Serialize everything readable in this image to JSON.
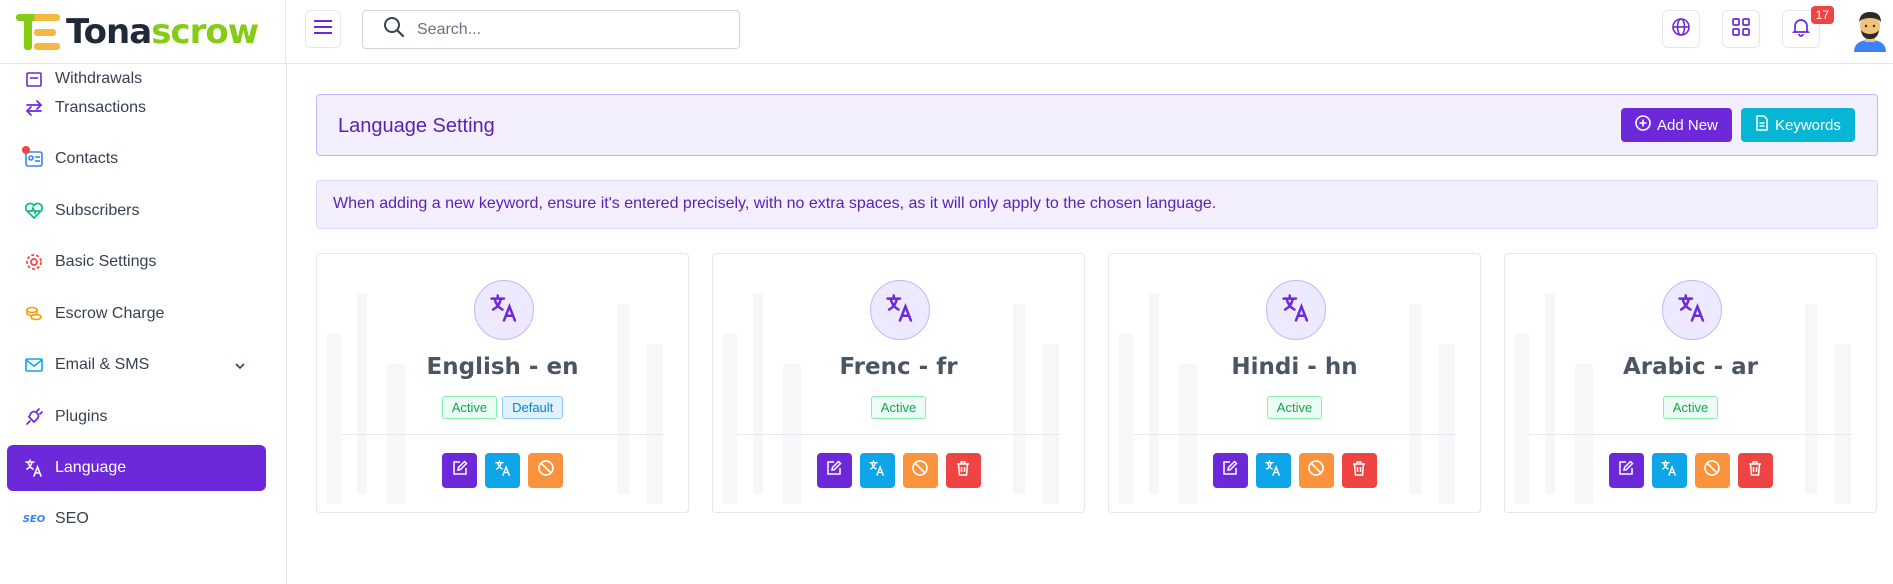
{
  "brand": {
    "name_part1": "Tona",
    "name_part2": "scrow",
    "colors": {
      "dark": "#1f2937",
      "accent": "#84cc16",
      "yellow": "#f5b942"
    }
  },
  "header": {
    "search_placeholder": "Search...",
    "notification_count": "17",
    "icons": [
      "menu-icon",
      "search-icon",
      "globe-icon",
      "grid-icon",
      "bell-icon"
    ]
  },
  "sidebar": {
    "items": [
      {
        "label": "Withdrawals",
        "icon": "receipt-icon"
      },
      {
        "label": "Transactions",
        "icon": "arrows-left-right-icon"
      },
      {
        "label": "Contacts",
        "icon": "contact-card-icon"
      },
      {
        "label": "Subscribers",
        "icon": "heart-pulse-icon"
      },
      {
        "label": "Basic Settings",
        "icon": "gear-icon"
      },
      {
        "label": "Escrow Charge",
        "icon": "coins-icon"
      },
      {
        "label": "Email & SMS",
        "icon": "mail-icon"
      },
      {
        "label": "Plugins",
        "icon": "plug-icon"
      },
      {
        "label": "Language",
        "icon": "translate-icon",
        "active": true
      },
      {
        "label": "SEO",
        "icon": "seo-icon"
      }
    ]
  },
  "panel": {
    "title": "Language Setting",
    "add_new_label": "Add New",
    "keywords_label": "Keywords"
  },
  "notice": "When adding a new keyword, ensure it's entered precisely, with no extra spaces, as it will only apply to the chosen language.",
  "languages": [
    {
      "name": "English - en",
      "status": "Active",
      "default_label": "Default"
    },
    {
      "name": "Frenc - fr",
      "status": "Active"
    },
    {
      "name": "Hindi - hn",
      "status": "Active"
    },
    {
      "name": "Arabic - ar",
      "status": "Active"
    }
  ],
  "colors": {
    "primary": "#6d28d9",
    "cyan": "#06b6d4",
    "orange": "#fb923c",
    "red": "#ef4444",
    "green": "#16a34a"
  }
}
